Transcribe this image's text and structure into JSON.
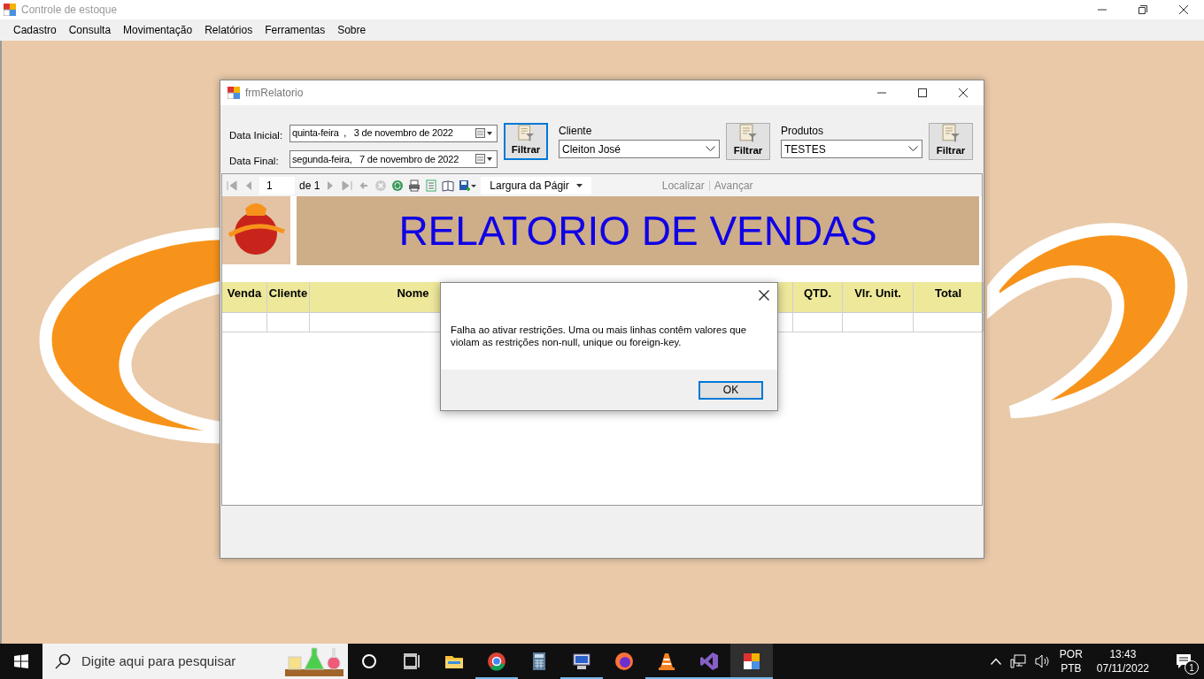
{
  "window": {
    "title": "Controle de estoque"
  },
  "menu": [
    "Cadastro",
    "Consulta",
    "Movimentação",
    "Relatórios",
    "Ferramentas",
    "Sobre"
  ],
  "report_window": {
    "title": "frmRelatorio",
    "date_filters": [
      {
        "label": "Data Inicial:",
        "value": "quinta-feira  ,   3 de novembro de 2022"
      },
      {
        "label": "Data Final:",
        "value": "segunda-feira,   7 de novembro de 2022"
      }
    ],
    "filter_buttons": [
      {
        "label": "Filtrar",
        "focused": true
      },
      {
        "label": "Filtrar",
        "focused": false
      },
      {
        "label": "Filtrar",
        "focused": false
      }
    ],
    "combos": [
      {
        "label": "Cliente",
        "value": "Cleiton José"
      },
      {
        "label": "Produtos",
        "value": "TESTES"
      }
    ],
    "report_toolbar": {
      "page": "1",
      "page_count": "de 1",
      "zoom": "Largura da Págir",
      "find": "Localizar",
      "next": "Avançar"
    },
    "report": {
      "title": "RELATORIO DE VENDAS",
      "columns": [
        {
          "label": "Venda",
          "kind": "narrow"
        },
        {
          "label": "Cliente",
          "kind": "narrow"
        },
        {
          "label": "Nome",
          "kind": "wide"
        },
        {
          "label": "QTD.",
          "kind": "narrow"
        },
        {
          "label": "Vlr. Unit.",
          "kind": "medium"
        },
        {
          "label": "Total",
          "kind": "medium"
        }
      ]
    }
  },
  "dialog": {
    "message": "Falha ao ativar restrições. Uma ou mais linhas contêm valores que violam as restrições non-null, unique ou foreign-key.",
    "button": "OK"
  },
  "taskbar": {
    "search_placeholder": "Digite aqui para pesquisar",
    "apps": [
      {
        "kind": "folder",
        "running": false,
        "selected": false
      },
      {
        "kind": "browser",
        "running": true,
        "selected": false
      },
      {
        "kind": "calculator",
        "running": false,
        "selected": false
      },
      {
        "kind": "network",
        "running": true,
        "selected": false
      },
      {
        "kind": "fox",
        "running": false,
        "selected": false
      },
      {
        "kind": "cone",
        "running": true,
        "selected": false
      },
      {
        "kind": "studio",
        "running": true,
        "selected": false
      },
      {
        "kind": "app",
        "running": true,
        "selected": true
      }
    ],
    "tray": {
      "language": "POR",
      "layout": "PTB",
      "time": "13:43",
      "date": "07/11/2022",
      "notifications": "1"
    }
  }
}
